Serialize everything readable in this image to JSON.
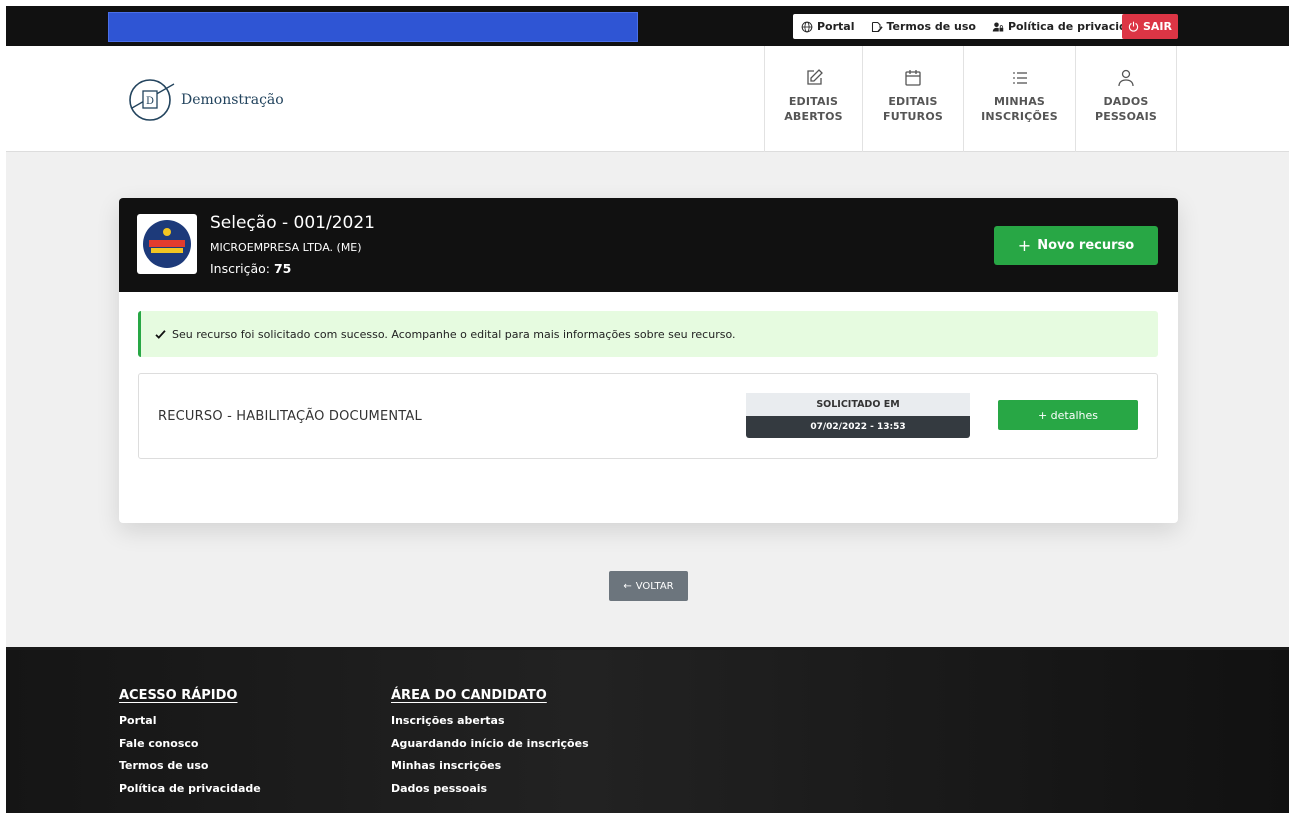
{
  "topbar": {
    "links": [
      {
        "label": "Portal",
        "icon": "globe-icon"
      },
      {
        "label": "Termos de uso",
        "icon": "file-signature-icon"
      },
      {
        "label": "Política de privacidade",
        "icon": "user-lock-icon"
      }
    ],
    "logout_label": "SAIR",
    "logout_color": "#dc3545"
  },
  "header": {
    "logo_text": "Demonstração",
    "logo_letter": "D",
    "nav": [
      {
        "label": "EDITAIS\nABERTOS",
        "icon": "edit-icon"
      },
      {
        "label": "EDITAIS\nFUTUROS",
        "icon": "calendar-icon"
      },
      {
        "label": "MINHAS\nINSCRIÇÕES",
        "icon": "list-icon"
      },
      {
        "label": "DADOS\nPESSOAIS",
        "icon": "user-icon"
      }
    ]
  },
  "card": {
    "title": "Seleção - 001/2021",
    "subtitle": "MICROEMPRESA LTDA. (ME)",
    "inscricao_label": "Inscrição:",
    "inscricao_value": "75",
    "new_button_label": "Novo recurso",
    "alert_text": "Seu recurso foi solicitado com sucesso. Acompanhe o edital para mais informações sobre seu recurso.",
    "recurso": {
      "title": "RECURSO - HABILITAÇÃO DOCUMENTAL",
      "requested_label": "SOLICITADO EM",
      "requested_value": "07/02/2022 - 13:53",
      "details_label": "+ detalhes"
    }
  },
  "back_label": "VOLTAR",
  "footer": {
    "col1": {
      "title": "ACESSO RÁPIDO",
      "items": [
        "Portal",
        "Fale conosco",
        "Termos de uso",
        "Política de privacidade"
      ]
    },
    "col2": {
      "title": "ÁREA DO CANDIDATO",
      "items": [
        "Inscrições abertas",
        "Aguardando início de inscrições",
        "Minhas inscrições",
        "Dados pessoais"
      ]
    }
  },
  "colors": {
    "accent_green": "#28a745",
    "dark": "#111111",
    "placeholder_blue": "#2f55d4"
  }
}
